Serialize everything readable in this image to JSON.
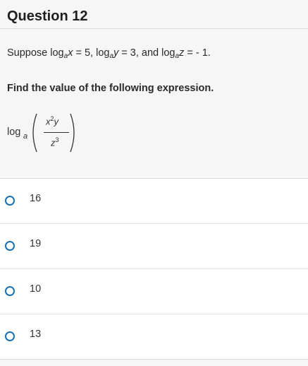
{
  "question": {
    "title": "Question 12",
    "stem": {
      "prefix": "Suppose log",
      "parts": [
        {
          "base": "a",
          "var": "x",
          "value": "= 5,"
        },
        {
          "base": "a",
          "var": "y",
          "value": "= 3, and log"
        },
        {
          "base": "a",
          "var": "z",
          "value": "= - 1."
        }
      ]
    },
    "instruction": "Find the value of the following expression.",
    "expression": {
      "log": "log",
      "base": "a",
      "numerator_x": "x",
      "numerator_x_exp": "2",
      "numerator_y": "y",
      "denominator_z": "z",
      "denominator_z_exp": "3"
    }
  },
  "options": [
    {
      "label": "16"
    },
    {
      "label": "19"
    },
    {
      "label": "10"
    },
    {
      "label": "13"
    }
  ],
  "colors": {
    "radio_border": "#1a6fb5",
    "panel_bg": "#f6f6f6"
  }
}
